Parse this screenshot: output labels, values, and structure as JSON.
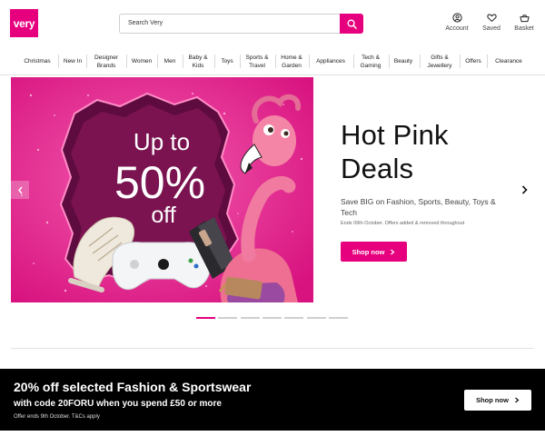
{
  "header": {
    "logo": "very",
    "search_placeholder": "Search Very",
    "account_label": "Account",
    "saved_label": "Saved",
    "basket_label": "Basket"
  },
  "nav": {
    "items": [
      "Christmas",
      "New In",
      "Designer Brands",
      "Women",
      "Men",
      "Baby & Kids",
      "Toys",
      "Sports & Travel",
      "Home & Garden",
      "Appliances",
      "Tech & Gaming",
      "Beauty",
      "Gifts & Jewellery",
      "Offers",
      "Clearance"
    ]
  },
  "hero": {
    "image_text_1": "Up to",
    "image_text_2": "50%",
    "image_text_3": "off",
    "title_line1": "Hot Pink",
    "title_line2": "Deals",
    "subtitle": "Save BIG on Fashion, Sports, Beauty, Toys & Tech",
    "small_print": "Ends 09th October. Offers added & removed throughout",
    "button_label": "Shop now",
    "slide_count": 7,
    "active_slide": 1
  },
  "promo": {
    "title": "20% off selected Fashion & Sportswear",
    "subtitle": "with code 20FORU when you spend £50 or more",
    "fine_print": "Offer ends 9th October. T&Cs apply",
    "button_label": "Shop now"
  },
  "colors": {
    "brand_pink": "#e6007e",
    "promo_background": "#000000"
  },
  "icons": [
    "search-icon",
    "account-icon",
    "heart-icon",
    "basket-icon",
    "chevron-left-icon",
    "chevron-right-icon"
  ]
}
